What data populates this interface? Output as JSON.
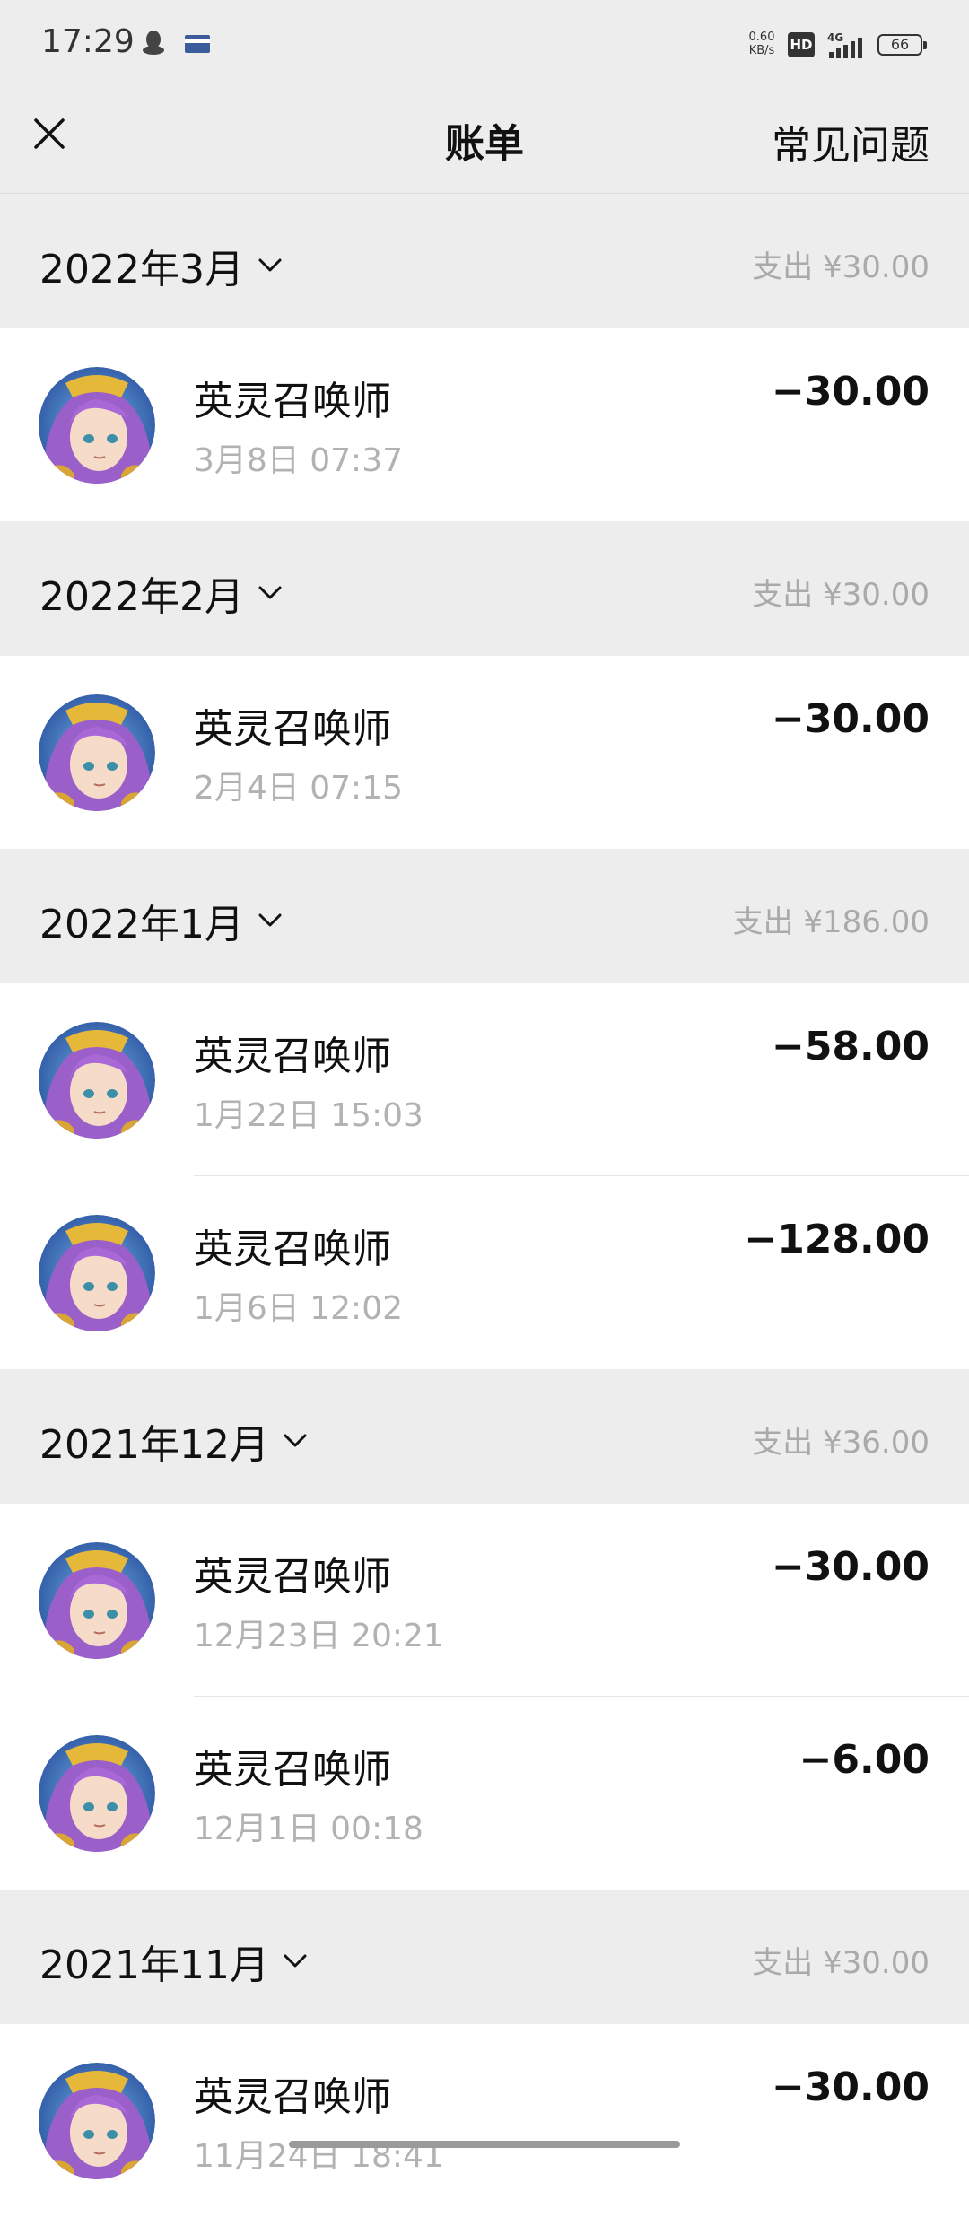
{
  "status_bar": {
    "time": "17:29",
    "speed_value": "0.60",
    "speed_unit": "KB/s",
    "hd": "HD",
    "network": "4G",
    "battery": "66"
  },
  "header": {
    "title": "账单",
    "faq_label": "常见问题"
  },
  "colors": {
    "background": "#ededed",
    "row_bg": "#ffffff",
    "secondary_text": "#b2b2b2"
  },
  "months": [
    {
      "label": "2022年3月",
      "total": "支出 ¥30.00",
      "items": [
        {
          "merchant": "英灵召唤师",
          "time": "3月8日 07:37",
          "amount": "−30.00"
        }
      ]
    },
    {
      "label": "2022年2月",
      "total": "支出 ¥30.00",
      "items": [
        {
          "merchant": "英灵召唤师",
          "time": "2月4日 07:15",
          "amount": "−30.00"
        }
      ]
    },
    {
      "label": "2022年1月",
      "total": "支出 ¥186.00",
      "items": [
        {
          "merchant": "英灵召唤师",
          "time": "1月22日 15:03",
          "amount": "−58.00"
        },
        {
          "merchant": "英灵召唤师",
          "time": "1月6日 12:02",
          "amount": "−128.00"
        }
      ]
    },
    {
      "label": "2021年12月",
      "total": "支出 ¥36.00",
      "items": [
        {
          "merchant": "英灵召唤师",
          "time": "12月23日 20:21",
          "amount": "−30.00"
        },
        {
          "merchant": "英灵召唤师",
          "time": "12月1日 00:18",
          "amount": "−6.00"
        }
      ]
    },
    {
      "label": "2021年11月",
      "total": "支出 ¥30.00",
      "items": [
        {
          "merchant": "英灵召唤师",
          "time": "11月24日 18:41",
          "amount": "−30.00"
        }
      ]
    }
  ]
}
